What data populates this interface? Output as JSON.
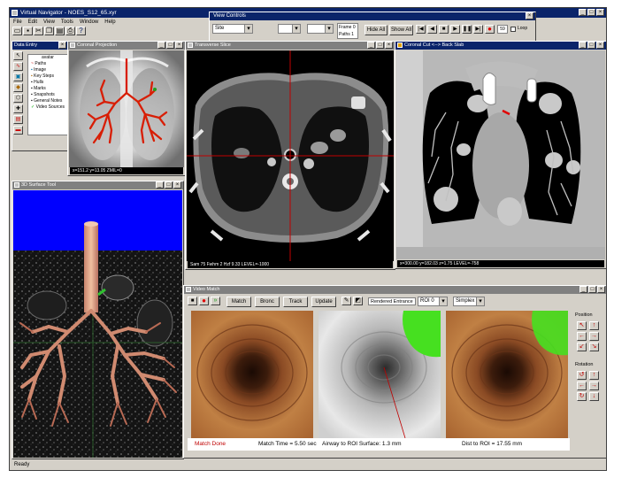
{
  "app": {
    "title": "Virtual Navigator - NOES_S12_65.xyr",
    "menu": [
      "File",
      "Edit",
      "View",
      "Tools",
      "Window",
      "Help"
    ],
    "status": "Ready"
  },
  "toolbar": {
    "icons": [
      "new-icon",
      "open-icon",
      "save-icon",
      "cut-icon",
      "copy-icon",
      "paste-icon",
      "print-icon",
      "help-icon"
    ]
  },
  "view_controls": {
    "title": "View Controls",
    "site_value": "Site",
    "frame_value": "Frame 0",
    "paths_value": "Paths 1",
    "hide_all": "Hide All",
    "show_all": "Show All",
    "frame_num": "59",
    "loop_label": "Loop"
  },
  "data_window": {
    "title": "Data Entry",
    "header": "avatar",
    "items": [
      "Paths",
      "Image",
      "Key Steps",
      "Hulls",
      "Marks",
      "Snapshots",
      "General Notes",
      "Video Sources"
    ]
  },
  "coronal_projection": {
    "title": "Coronal Projection",
    "status": "x=151.2 y=13.05 ZMIL=0"
  },
  "transverse_slice": {
    "title": "Transverse Slice",
    "status": "Sam 75  Fwhm 2  Hzf 9.33  LEVEL=-1000"
  },
  "coronal_cut": {
    "title": "Coronal Cut <--> Back Slab",
    "status": "x=300.00 y=182.03 z=1.75  LEVEL=-758"
  },
  "surface_tool": {
    "title": "3D Surface Tool"
  },
  "video_match": {
    "title": "Video Match",
    "match_btn": "Match",
    "bronc_btn": "Bronc",
    "track_btn": "Track",
    "update_btn": "Update",
    "render_label": "Rendered Entrance",
    "roi_value": "ROI 0",
    "mode_value": "Simplex",
    "panel_header": "Position",
    "rotation_header": "Rotation",
    "match_status": "Match Done",
    "match_time": "Match Time =  5.50 sec",
    "airway_dist": "Airway to ROI Surface:  1.3 mm",
    "dist_roi": "Dist to ROI =  17.55 mm"
  },
  "colors": {
    "title_active": "#0a246a",
    "title_inactive": "#808080",
    "window_bg": "#d4d0c8",
    "airway_red": "#d81e05",
    "match_status": "#c00000"
  }
}
